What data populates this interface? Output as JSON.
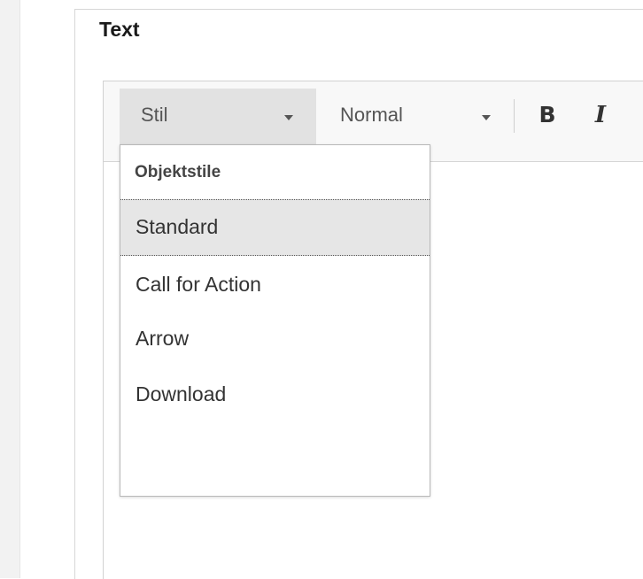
{
  "field": {
    "label": "Text"
  },
  "toolbar": {
    "style_combo": {
      "label": "Stil",
      "icon": "chevron-down-icon"
    },
    "format_combo": {
      "label": "Normal",
      "icon": "chevron-down-icon"
    },
    "bold_label": "B",
    "italic_label": "I"
  },
  "style_dropdown": {
    "group_header": "Objektstile",
    "items": [
      {
        "label": "Standard",
        "selected": true
      },
      {
        "label": "Call for Action",
        "selected": false
      },
      {
        "label": "Arrow",
        "selected": false
      },
      {
        "label": "Download",
        "selected": false
      }
    ]
  },
  "colors": {
    "selected_item_bg": "#e6e6e6",
    "active_combo_bg": "#e2e2e2",
    "toolbar_bg": "#f8f8f8"
  }
}
